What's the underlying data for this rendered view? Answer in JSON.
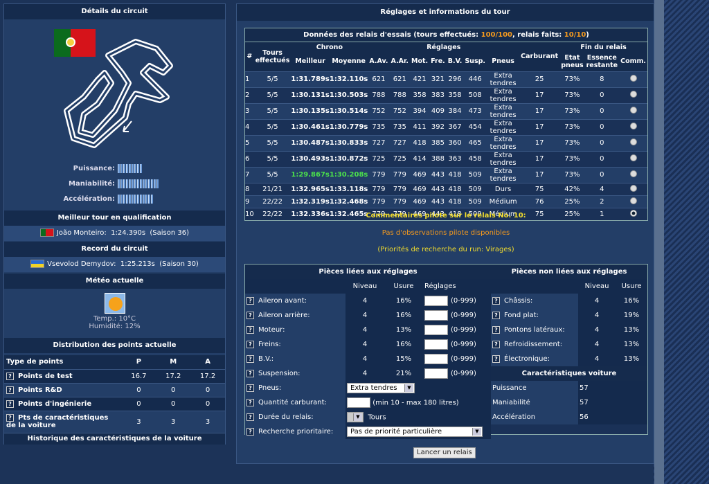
{
  "left": {
    "title": "Détails du circuit",
    "stats": [
      {
        "label": "Puissance:",
        "bars": 9
      },
      {
        "label": "Maniabilité:",
        "bars": 15
      },
      {
        "label": "Accélération:",
        "bars": 13
      }
    ],
    "best_qual": {
      "title": "Meilleur tour en qualification",
      "driver": "João Monteiro:",
      "time": "1:24.390s",
      "season": "(Saison 36)"
    },
    "record": {
      "title": "Record du circuit",
      "driver": "Vsevolod Demydov:",
      "time": "1:25.213s",
      "season": "(Saison 30)"
    },
    "weather": {
      "title": "Météo actuelle",
      "temp": "Temp.: 10°C",
      "humidity": "Humidité: 12%"
    },
    "points": {
      "title": "Distribution des points actuelle",
      "headers": [
        "Type de points",
        "P",
        "M",
        "A"
      ],
      "rows": [
        {
          "label": "Points de test",
          "p": "16.7",
          "m": "17.2",
          "a": "17.2"
        },
        {
          "label": "Points R&D",
          "p": "0",
          "m": "0",
          "a": "0"
        },
        {
          "label": "Points d'ingénierie",
          "p": "0",
          "m": "0",
          "a": "0"
        },
        {
          "label": "Pts de caractéristiques de la voiture",
          "p": "3",
          "m": "3",
          "a": "3"
        }
      ]
    },
    "history": "Historique des caractéristiques de la voiture"
  },
  "right": {
    "title": "Réglages et informations du tour",
    "stints_caption": {
      "pre": "Données des relais d'essais (tours effectués: ",
      "laps": "100/100",
      "mid": ", relais faits: ",
      "stints": "10/10",
      "post": ")"
    },
    "headers": {
      "hash": "#",
      "tours": "Tours effectués",
      "chrono": "Chrono",
      "reglages": "Réglages",
      "fin": "Fin du relais",
      "best": "Meilleur",
      "avg": "Moyenne",
      "aav": "A.Av.",
      "aar": "A.Ar.",
      "mot": "Mot.",
      "fre": "Fre.",
      "bv": "B.V.",
      "susp": "Susp.",
      "pneus": "Pneus",
      "carb": "Carburant",
      "etat": "Etat pneus",
      "ess": "Essence restante",
      "comm": "Comm."
    },
    "rows": [
      {
        "n": "1",
        "tours": "5/5",
        "best": "1:31.789s",
        "avg": "1:32.110s",
        "aav": "621",
        "aar": "621",
        "mot": "421",
        "fre": "321",
        "bv": "296",
        "susp": "446",
        "pneus": "Extra tendres",
        "carb": "25",
        "etat": "73%",
        "ess": "8"
      },
      {
        "n": "2",
        "tours": "5/5",
        "best": "1:30.131s",
        "avg": "1:30.503s",
        "aav": "788",
        "aar": "788",
        "mot": "358",
        "fre": "383",
        "bv": "358",
        "susp": "508",
        "pneus": "Extra tendres",
        "carb": "17",
        "etat": "73%",
        "ess": "0"
      },
      {
        "n": "3",
        "tours": "5/5",
        "best": "1:30.135s",
        "avg": "1:30.514s",
        "aav": "752",
        "aar": "752",
        "mot": "394",
        "fre": "409",
        "bv": "384",
        "susp": "473",
        "pneus": "Extra tendres",
        "carb": "17",
        "etat": "73%",
        "ess": "0"
      },
      {
        "n": "4",
        "tours": "5/5",
        "best": "1:30.461s",
        "avg": "1:30.779s",
        "aav": "735",
        "aar": "735",
        "mot": "411",
        "fre": "392",
        "bv": "367",
        "susp": "454",
        "pneus": "Extra tendres",
        "carb": "17",
        "etat": "73%",
        "ess": "0"
      },
      {
        "n": "5",
        "tours": "5/5",
        "best": "1:30.487s",
        "avg": "1:30.833s",
        "aav": "727",
        "aar": "727",
        "mot": "418",
        "fre": "385",
        "bv": "360",
        "susp": "465",
        "pneus": "Extra tendres",
        "carb": "17",
        "etat": "73%",
        "ess": "0"
      },
      {
        "n": "6",
        "tours": "5/5",
        "best": "1:30.493s",
        "avg": "1:30.872s",
        "aav": "725",
        "aar": "725",
        "mot": "414",
        "fre": "388",
        "bv": "363",
        "susp": "458",
        "pneus": "Extra tendres",
        "carb": "17",
        "etat": "73%",
        "ess": "0"
      },
      {
        "n": "7",
        "tours": "5/5",
        "best": "1:29.867s",
        "avg": "1:30.208s",
        "aav": "779",
        "aar": "779",
        "mot": "469",
        "fre": "443",
        "bv": "418",
        "susp": "509",
        "pneus": "Extra tendres",
        "carb": "17",
        "etat": "73%",
        "ess": "0",
        "highlight": true
      },
      {
        "n": "8",
        "tours": "21/21",
        "best": "1:32.965s",
        "avg": "1:33.118s",
        "aav": "779",
        "aar": "779",
        "mot": "469",
        "fre": "443",
        "bv": "418",
        "susp": "509",
        "pneus": "Durs",
        "carb": "75",
        "etat": "42%",
        "ess": "4"
      },
      {
        "n": "9",
        "tours": "22/22",
        "best": "1:32.319s",
        "avg": "1:32.468s",
        "aav": "779",
        "aar": "779",
        "mot": "469",
        "fre": "443",
        "bv": "418",
        "susp": "509",
        "pneus": "Médium",
        "carb": "76",
        "etat": "25%",
        "ess": "2"
      },
      {
        "n": "10",
        "tours": "22/22",
        "best": "1:32.336s",
        "avg": "1:32.465s",
        "aav": "779",
        "aar": "779",
        "mot": "469",
        "fre": "443",
        "bv": "418",
        "susp": "509",
        "pneus": "Médium",
        "carb": "75",
        "etat": "25%",
        "ess": "1",
        "selected": true
      }
    ],
    "comments": {
      "title": "Commentaires pilote sur le relais No. 10:",
      "text": "Pas d'observations pilote disponibles",
      "priority": "(Priorités de recherche du run: Virages)"
    },
    "parts": {
      "title_linked": "Pièces liées aux réglages",
      "title_unlinked": "Pièces non liées aux réglages",
      "h_niveau": "Niveau",
      "h_usure": "Usure",
      "h_reglages": "Réglages",
      "linked": [
        {
          "label": "Aileron avant:",
          "niveau": "4",
          "usure": "16%",
          "range": "(0-999)"
        },
        {
          "label": "Aileron arrière:",
          "niveau": "4",
          "usure": "16%",
          "range": "(0-999)"
        },
        {
          "label": "Moteur:",
          "niveau": "4",
          "usure": "13%",
          "range": "(0-999)"
        },
        {
          "label": "Freins:",
          "niveau": "4",
          "usure": "16%",
          "range": "(0-999)"
        },
        {
          "label": "B.V.:",
          "niveau": "4",
          "usure": "15%",
          "range": "(0-999)"
        },
        {
          "label": "Suspension:",
          "niveau": "4",
          "usure": "21%",
          "range": "(0-999)"
        }
      ],
      "unlinked": [
        {
          "label": "Châssis:",
          "niveau": "4",
          "usure": "16%"
        },
        {
          "label": "Fond plat:",
          "niveau": "4",
          "usure": "19%"
        },
        {
          "label": "Pontons latéraux:",
          "niveau": "4",
          "usure": "13%"
        },
        {
          "label": "Refroidissement:",
          "niveau": "4",
          "usure": "13%"
        },
        {
          "label": "Électronique:",
          "niveau": "4",
          "usure": "13%"
        }
      ],
      "car_title": "Caractéristiques voiture",
      "car": [
        {
          "label": "Puissance",
          "value": "57"
        },
        {
          "label": "Maniabilité",
          "value": "57"
        },
        {
          "label": "Accélération",
          "value": "56"
        }
      ],
      "pneus_label": "Pneus:",
      "pneus_value": "Extra tendres",
      "carb_label": "Quantité carburant:",
      "carb_hint": "(min 10 - max 180 litres)",
      "duree_label": "Durée du relais:",
      "duree_unit": "Tours",
      "prio_label": "Recherche prioritaire:",
      "prio_value": "Pas de priorité particulière"
    },
    "launch": "Lancer un relais"
  }
}
